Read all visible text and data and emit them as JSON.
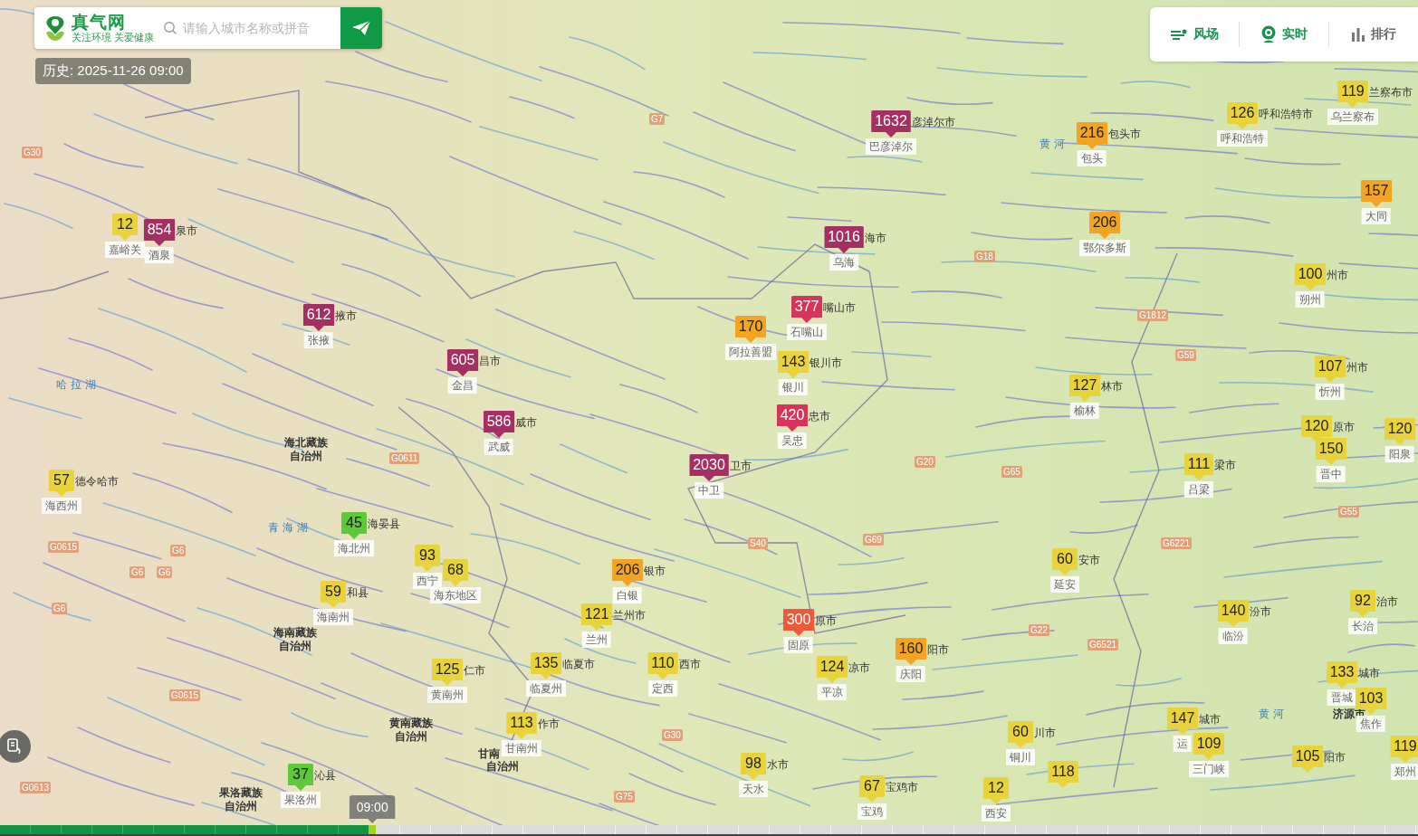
{
  "search": {
    "logo": "真气网",
    "tagline": "关注环境 关爱健康",
    "placeholder": "请输入城市名称或拼音"
  },
  "history": "历史: 2025-11-26 09:00",
  "layer_tabs": [
    {
      "label": "风场",
      "active": true
    },
    {
      "label": "实时",
      "active": true
    },
    {
      "label": "排行",
      "active": false
    }
  ],
  "map": {
    "place_labels": [
      {
        "text": "哈拉湖",
        "kind": "water"
      },
      {
        "text": "海北藏族自治州",
        "kind": "place"
      },
      {
        "text": "青海湖",
        "kind": "water"
      },
      {
        "text": "海南藏族自治州",
        "kind": "place"
      },
      {
        "text": "黄南藏族自治州",
        "kind": "place"
      },
      {
        "text": "甘南",
        "kind": "place"
      },
      {
        "text": "自治州",
        "kind": "place"
      },
      {
        "text": "果洛藏族自治州",
        "kind": "place"
      },
      {
        "text": "济源市",
        "kind": "place"
      },
      {
        "text": "黄河",
        "kind": "water"
      },
      {
        "text": "黄河",
        "kind": "water"
      }
    ],
    "road_labels": [
      "G7",
      "G30",
      "G18",
      "G1812",
      "G59",
      "G20",
      "G65",
      "G0611",
      "G0615",
      "G6",
      "G6",
      "G6",
      "G6",
      "S40",
      "G69",
      "G22",
      "G6521",
      "G6221",
      "G55",
      "G30",
      "G75",
      "G0615",
      "G0613"
    ],
    "stations": [
      {
        "aqi": "1632",
        "color": "#a42f63",
        "side": "彦淖尔市",
        "label": "巴彦淖尔"
      },
      {
        "aqi": "216",
        "color": "#f4a423",
        "side": "包头市",
        "label": "包头"
      },
      {
        "aqi": "126",
        "color": "#e9d33c",
        "side": "呼和浩特市",
        "label": "呼和浩特"
      },
      {
        "aqi": "119",
        "color": "#e9d33c",
        "side": "兰察布市",
        "label": "乌兰察布"
      },
      {
        "aqi": "157",
        "color": "#f4a423",
        "label": "大同"
      },
      {
        "aqi": "12",
        "color": "#e9d33c",
        "label": "嘉峪关"
      },
      {
        "aqi": "854",
        "color": "#a42f63",
        "side": "泉市",
        "label": "酒泉"
      },
      {
        "aqi": "1016",
        "color": "#a42f63",
        "side": "海市",
        "label": "乌海"
      },
      {
        "aqi": "206",
        "color": "#f4a423",
        "label": "鄂尔多斯"
      },
      {
        "aqi": "100",
        "color": "#e9d33c",
        "side": "州市",
        "label": "朔州"
      },
      {
        "aqi": "612",
        "color": "#a42f63",
        "side": "掖市",
        "label": "张掖"
      },
      {
        "aqi": "170",
        "color": "#f4a423",
        "label": "阿拉善盟"
      },
      {
        "aqi": "377",
        "color": "#d8335a",
        "side": "嘴山市",
        "label": "石嘴山"
      },
      {
        "aqi": "605",
        "color": "#a42f63",
        "side": "昌市",
        "label": "金昌"
      },
      {
        "aqi": "143",
        "color": "#e9d33c",
        "side": "银川市",
        "label": "银川"
      },
      {
        "aqi": "127",
        "color": "#e9d33c",
        "side": "林市",
        "label": "榆林"
      },
      {
        "aqi": "107",
        "color": "#e9d33c",
        "side": "州市",
        "label": "忻州"
      },
      {
        "aqi": "586",
        "color": "#a42f63",
        "side": "威市",
        "label": "武威"
      },
      {
        "aqi": "420",
        "color": "#d8335a",
        "side": "忠市",
        "label": "吴忠"
      },
      {
        "aqi": "120",
        "color": "#e9d33c",
        "side": "原市"
      },
      {
        "aqi": "150",
        "color": "#e9d33c",
        "label": "晋中"
      },
      {
        "aqi": "120",
        "color": "#e9d33c",
        "label": "阳泉"
      },
      {
        "aqi": "57",
        "color": "#e9d33c",
        "side": "德令哈市",
        "label": "海西州"
      },
      {
        "aqi": "2030",
        "color": "#a42f63",
        "side": "卫市",
        "label": "中卫"
      },
      {
        "aqi": "111",
        "color": "#e9d33c",
        "side": "梁市",
        "label": "吕梁"
      },
      {
        "aqi": "45",
        "color": "#5cc83a",
        "side": "海晏县",
        "label": "海北州"
      },
      {
        "aqi": "93",
        "color": "#e9d33c",
        "label": "西宁"
      },
      {
        "aqi": "68",
        "color": "#e9d33c",
        "label": "海东地区"
      },
      {
        "aqi": "206",
        "color": "#f4a423",
        "side": "银市",
        "label": "白银"
      },
      {
        "aqi": "60",
        "color": "#e9d33c",
        "side": "安市",
        "label": "延安"
      },
      {
        "aqi": "59",
        "color": "#e9d33c",
        "side": "和县",
        "label": "海南州"
      },
      {
        "aqi": "121",
        "color": "#e9d33c",
        "side": "兰州市",
        "label": "兰州"
      },
      {
        "aqi": "300",
        "color": "#f05a3c",
        "side": "原市",
        "label": "固原"
      },
      {
        "aqi": "140",
        "color": "#e9d33c",
        "side": "汾市",
        "label": "临汾"
      },
      {
        "aqi": "92",
        "color": "#e9d33c",
        "side": "治市",
        "label": "长治"
      },
      {
        "aqi": "160",
        "color": "#f4a423",
        "side": "阳市",
        "label": "庆阳"
      },
      {
        "aqi": "125",
        "color": "#e9d33c",
        "side": "仁市",
        "label": "黄南州"
      },
      {
        "aqi": "135",
        "color": "#e9d33c",
        "side": "临夏市",
        "label": "临夏州"
      },
      {
        "aqi": "110",
        "color": "#e9d33c",
        "side": "西市",
        "label": "定西"
      },
      {
        "aqi": "124",
        "color": "#e9d33c",
        "side": "凉市",
        "label": "平凉"
      },
      {
        "aqi": "133",
        "color": "#e9d33c",
        "side": "城市",
        "label": "晋城"
      },
      {
        "aqi": "103",
        "color": "#e9d33c",
        "label": "焦作"
      },
      {
        "aqi": "113",
        "color": "#e9d33c",
        "side": "作市",
        "label": "甘南州"
      },
      {
        "aqi": "60",
        "color": "#e9d33c",
        "side": "川市",
        "label": "铜川"
      },
      {
        "aqi": "147",
        "color": "#e9d33c",
        "side": "城市",
        "label": "运"
      },
      {
        "aqi": "37",
        "color": "#5cc83a",
        "side": "沁县",
        "label": "果洛州"
      },
      {
        "aqi": "98",
        "color": "#e9d33c",
        "side": "水市",
        "label": "天水"
      },
      {
        "aqi": "67",
        "color": "#e9d33c",
        "side": "宝鸡市",
        "label": "宝鸡"
      },
      {
        "aqi": "12",
        "color": "#e9d33c",
        "label": "西安"
      },
      {
        "aqi": "118",
        "color": "#e9d33c"
      },
      {
        "aqi": "109",
        "color": "#e9d33c",
        "label": "三门峡"
      },
      {
        "aqi": "105",
        "color": "#e9d33c",
        "side": "阳市"
      },
      {
        "aqi": "119",
        "color": "#e9d33c",
        "label": "郑州"
      }
    ]
  },
  "timeline": {
    "time": "09:00",
    "level": 0.26
  }
}
